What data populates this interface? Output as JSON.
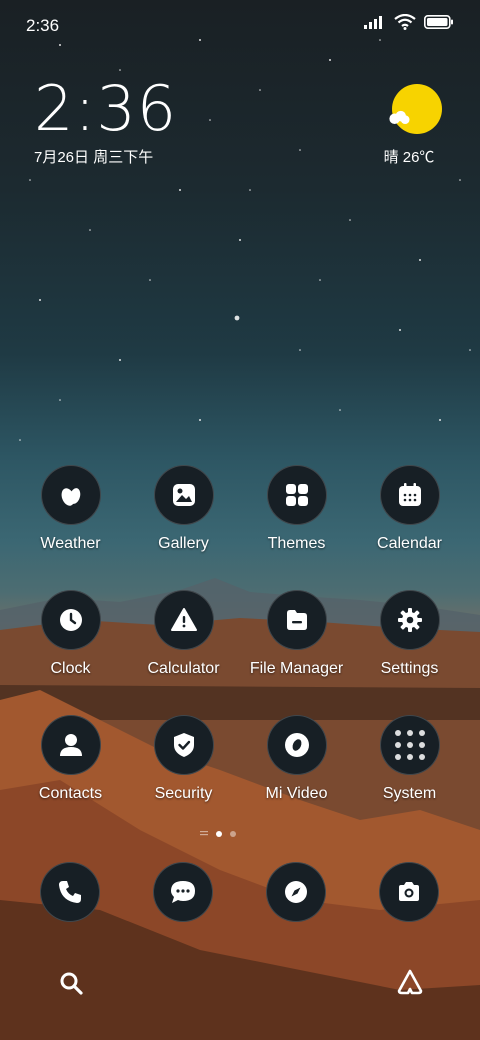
{
  "status_bar": {
    "time": "2:36"
  },
  "clock_widget": {
    "time": "2:36",
    "date": "7月26日 周三下午"
  },
  "weather_widget": {
    "summary": "晴 26℃",
    "sun_color": "#f7d300"
  },
  "apps": [
    {
      "label": "Weather",
      "icon": "weather-icon"
    },
    {
      "label": "Gallery",
      "icon": "gallery-icon"
    },
    {
      "label": "Themes",
      "icon": "themes-icon"
    },
    {
      "label": "Calendar",
      "icon": "calendar-icon"
    },
    {
      "label": "Clock",
      "icon": "clock-icon"
    },
    {
      "label": "Calculator",
      "icon": "calculator-icon"
    },
    {
      "label": "File Manager",
      "icon": "file-manager-icon"
    },
    {
      "label": "Settings",
      "icon": "settings-icon"
    },
    {
      "label": "Contacts",
      "icon": "contacts-icon"
    },
    {
      "label": "Security",
      "icon": "security-icon"
    },
    {
      "label": "Mi Video",
      "icon": "mi-video-icon"
    },
    {
      "label": "System",
      "icon": "system-folder-icon"
    }
  ],
  "dock": [
    {
      "icon": "phone-icon"
    },
    {
      "icon": "messages-icon"
    },
    {
      "icon": "browser-compass-icon"
    },
    {
      "icon": "camera-icon"
    }
  ],
  "page_indicator": {
    "pages": 3,
    "active": 1
  },
  "bottom_bar": [
    {
      "icon": "search-icon"
    },
    {
      "icon": "app-vault-icon"
    }
  ]
}
